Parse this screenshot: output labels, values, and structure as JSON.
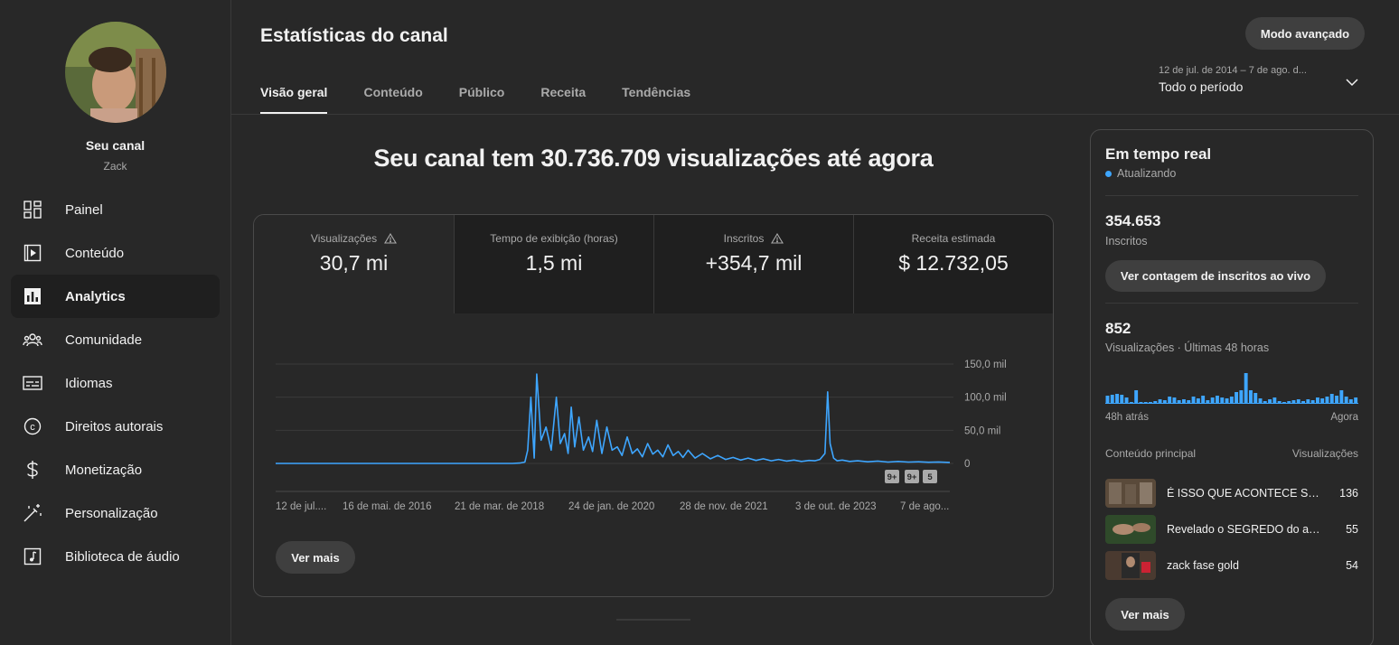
{
  "sidebar": {
    "channel_name": "Seu canal",
    "channel_handle": "Zack",
    "items": [
      {
        "label": "Painel",
        "icon": "dashboard-icon"
      },
      {
        "label": "Conteúdo",
        "icon": "content-icon"
      },
      {
        "label": "Analytics",
        "icon": "analytics-icon",
        "active": true
      },
      {
        "label": "Comunidade",
        "icon": "community-icon"
      },
      {
        "label": "Idiomas",
        "icon": "subtitles-icon"
      },
      {
        "label": "Direitos autorais",
        "icon": "copyright-icon"
      },
      {
        "label": "Monetização",
        "icon": "dollar-icon"
      },
      {
        "label": "Personalização",
        "icon": "magic-wand-icon"
      },
      {
        "label": "Biblioteca de áudio",
        "icon": "audio-library-icon"
      }
    ]
  },
  "header": {
    "title": "Estatísticas do canal",
    "advanced_mode": "Modo avançado",
    "tabs": [
      "Visão geral",
      "Conteúdo",
      "Público",
      "Receita",
      "Tendências"
    ],
    "period_range": "12 de jul. de 2014 – 7 de ago. d...",
    "period_label": "Todo o período"
  },
  "headline": "Seu canal tem 30.736.709 visualizações até agora",
  "metrics": [
    {
      "label": "Visualizações",
      "value": "30,7 mi",
      "warning": true
    },
    {
      "label": "Tempo de exibição (horas)",
      "value": "1,5 mi",
      "warning": false
    },
    {
      "label": "Inscritos",
      "value": "+354,7 mil",
      "warning": true
    },
    {
      "label": "Receita estimada",
      "value": "$ 12.732,05",
      "warning": false
    }
  ],
  "chart_data": {
    "type": "line",
    "x_tick_labels": [
      "12 de jul....",
      "16 de mai. de 2016",
      "21 de mar. de 2018",
      "24 de jan. de 2020",
      "28 de nov. de 2021",
      "3 de out. de 2023",
      "7 de ago..."
    ],
    "y_tick_labels": [
      "150,0 mil",
      "100,0 mil",
      "50,0 mil",
      "0"
    ],
    "ylim": [
      0,
      150000
    ],
    "xlim": [
      "2014-07-12",
      "2025-08-07"
    ],
    "series_color": "#3ea6ff",
    "series": [
      {
        "x": [
          "2014-07-12",
          "2016-01-01",
          "2017-06-01",
          "2018-06-01",
          "2018-07-15",
          "2018-08-15",
          "2018-09-01",
          "2018-09-20",
          "2018-10-10",
          "2018-10-25",
          "2018-11-20",
          "2018-12-20",
          "2019-01-20",
          "2019-02-20",
          "2019-03-15",
          "2019-04-10",
          "2019-05-01",
          "2019-05-20",
          "2019-06-10",
          "2019-07-05",
          "2019-08-01",
          "2019-09-01",
          "2019-09-25",
          "2019-10-20",
          "2019-11-20",
          "2019-12-20",
          "2020-01-20",
          "2020-02-20",
          "2020-03-20",
          "2020-04-20",
          "2020-05-20",
          "2020-06-20",
          "2020-07-20",
          "2020-08-20",
          "2020-09-20",
          "2020-10-20",
          "2020-11-20",
          "2020-12-20",
          "2021-01-20",
          "2021-02-20",
          "2021-03-20",
          "2021-04-20",
          "2021-06-01",
          "2021-07-15",
          "2021-09-01",
          "2021-10-15",
          "2021-12-01",
          "2022-01-15",
          "2022-03-01",
          "2022-04-15",
          "2022-06-01",
          "2022-07-15",
          "2022-09-01",
          "2022-10-15",
          "2022-12-01",
          "2023-01-15",
          "2023-03-01",
          "2023-04-15",
          "2023-05-20",
          "2023-06-20",
          "2023-07-20",
          "2023-08-05",
          "2023-08-20",
          "2023-09-10",
          "2023-10-01",
          "2023-11-01",
          "2023-12-15",
          "2024-02-01",
          "2024-04-01",
          "2024-06-01",
          "2024-08-01",
          "2024-10-01",
          "2024-12-01",
          "2025-02-01",
          "2025-04-01",
          "2025-06-01",
          "2025-08-07"
        ],
        "y": [
          0,
          0,
          0,
          0,
          500,
          2000,
          20000,
          100000,
          8000,
          135000,
          35000,
          55000,
          20000,
          100000,
          30000,
          45000,
          15000,
          85000,
          25000,
          70000,
          20000,
          40000,
          18000,
          65000,
          15000,
          55000,
          20000,
          25000,
          12000,
          40000,
          15000,
          22000,
          10000,
          30000,
          14000,
          20000,
          10000,
          28000,
          12000,
          18000,
          9000,
          20000,
          8000,
          15000,
          7000,
          12000,
          6000,
          9000,
          5000,
          8000,
          4500,
          7000,
          4000,
          6000,
          3500,
          5000,
          3000,
          4500,
          4000,
          6000,
          15000,
          108000,
          30000,
          8000,
          4000,
          5000,
          3000,
          4000,
          2500,
          3500,
          2000,
          3000,
          2000,
          2500,
          1800,
          2200,
          1500
        ]
      }
    ],
    "annotations": [
      "9+",
      "9+",
      "5"
    ]
  },
  "more_button": "Ver mais",
  "realtime": {
    "title": "Em tempo real",
    "status": "Atualizando",
    "subscribers_value": "354.653",
    "subscribers_label": "Inscritos",
    "live_count_button": "Ver contagem de inscritos ao vivo",
    "views_value": "852",
    "views_label": "Visualizações · Últimas 48 horas",
    "bars": [
      8,
      9,
      10,
      9,
      6,
      1,
      14,
      1,
      1,
      1,
      2,
      4,
      3,
      7,
      6,
      3,
      4,
      3,
      7,
      5,
      8,
      3,
      6,
      8,
      6,
      5,
      7,
      12,
      14,
      33,
      14,
      11,
      5,
      2,
      4,
      6,
      2,
      1,
      2,
      3,
      4,
      2,
      4,
      3,
      6,
      5,
      7,
      10,
      8,
      14,
      7,
      4,
      6
    ],
    "axis_left": "48h atrás",
    "axis_right": "Agora",
    "top_content_header": "Conteúdo principal",
    "top_content_value_header": "Visualizações",
    "top_content": [
      {
        "title": "É ISSO QUE ACONTECE SE ...",
        "views": "136"
      },
      {
        "title": "Revelado o SEGREDO do ant...",
        "views": "55"
      },
      {
        "title": "zack fase gold",
        "views": "54"
      }
    ],
    "more_button": "Ver mais"
  }
}
